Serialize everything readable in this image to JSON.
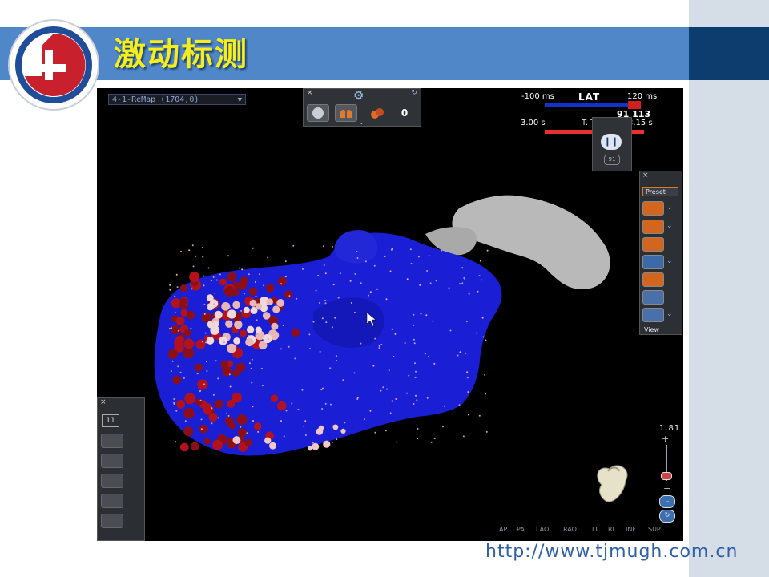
{
  "slide": {
    "title": "激动标测",
    "footer_url": "http://www.tjmugh.com.cn",
    "colors": {
      "title_band": "#4f87c8",
      "title_text": "#f5ee1c",
      "logo_red": "#c8202c",
      "logo_blue": "#1f4d9a"
    }
  },
  "mapper": {
    "map_name": "4-1-ReMap (1704,0)",
    "lat": {
      "title": "LAT",
      "min_label": "-100 ms",
      "max_label": "120 ms",
      "values": "91  113",
      "time_start": "3.00 s",
      "time_label": "T. Time",
      "time_end": "3.15 s"
    },
    "playback": {
      "pause_symbol": "❙❙",
      "count": "91"
    },
    "toolbar_top": {
      "close": "×",
      "gear": "⚙",
      "refresh": "↻",
      "count_symbol": "0"
    },
    "right_toolbar": {
      "close": "×",
      "preset_label": "Preset",
      "view_label": "View"
    },
    "left_panel": {
      "close": "×",
      "count": "11"
    },
    "zoom": {
      "value": "1.81",
      "plus": "+",
      "minus": "−"
    },
    "views": [
      "AP",
      "PA",
      "LAO",
      "RAO",
      "LL",
      "RL",
      "INF",
      "SUP"
    ]
  }
}
